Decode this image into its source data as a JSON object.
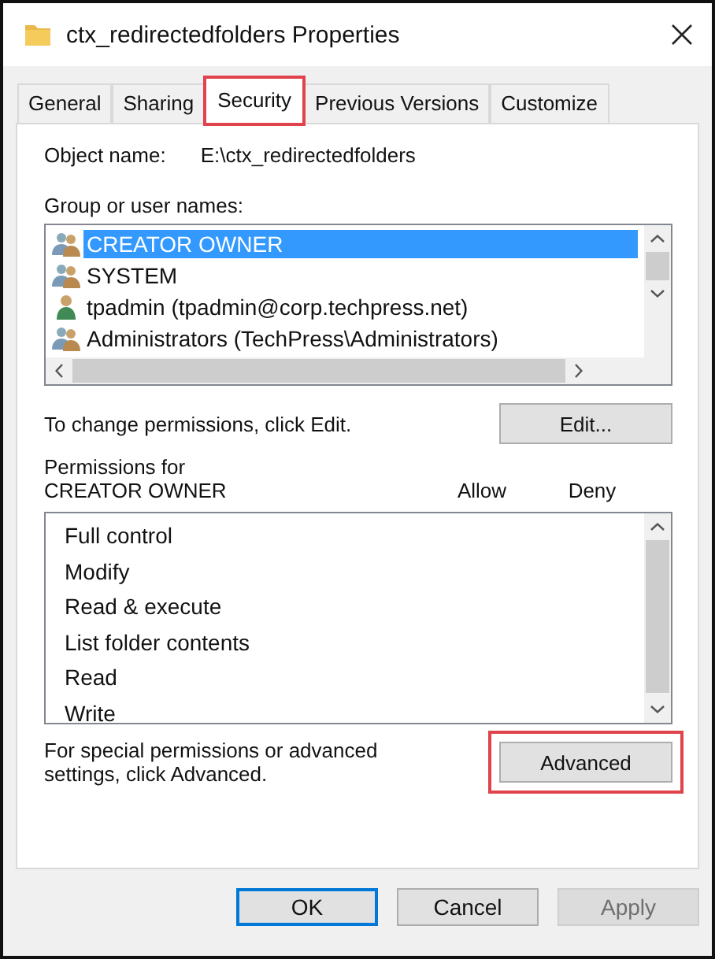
{
  "window": {
    "title": "ctx_redirectedfolders Properties"
  },
  "tabs": [
    {
      "label": "General",
      "selected": false,
      "highlighted": false
    },
    {
      "label": "Sharing",
      "selected": false,
      "highlighted": false
    },
    {
      "label": "Security",
      "selected": true,
      "highlighted": true
    },
    {
      "label": "Previous Versions",
      "selected": false,
      "highlighted": false
    },
    {
      "label": "Customize",
      "selected": false,
      "highlighted": false
    }
  ],
  "object_name": {
    "label": "Object name:",
    "value": "E:\\ctx_redirectedfolders"
  },
  "users": {
    "label": "Group or user names:",
    "items": [
      {
        "name": "CREATOR OWNER",
        "kind": "group",
        "selected": true
      },
      {
        "name": "SYSTEM",
        "kind": "group",
        "selected": false
      },
      {
        "name": "tpadmin (tpadmin@corp.techpress.net)",
        "kind": "user",
        "selected": false
      },
      {
        "name": "Administrators (TechPress\\Administrators)",
        "kind": "group",
        "selected": false
      }
    ]
  },
  "edit_hint": "To change permissions, click Edit.",
  "edit_button": {
    "label": "Edit...",
    "highlighted": false
  },
  "permissions": {
    "label": "Permissions for CREATOR OWNER",
    "allow": "Allow",
    "deny": "Deny",
    "items": [
      "Full control",
      "Modify",
      "Read & execute",
      "List folder contents",
      "Read",
      "Write"
    ]
  },
  "advanced_hint": "For special permissions or advanced settings, click Advanced.",
  "advanced_button": {
    "label": "Advanced",
    "highlighted": true
  },
  "buttons": [
    {
      "label": "OK",
      "kind": "default",
      "disabled": false
    },
    {
      "label": "Cancel",
      "kind": "normal",
      "disabled": false
    },
    {
      "label": "Apply",
      "kind": "normal",
      "disabled": true
    }
  ]
}
